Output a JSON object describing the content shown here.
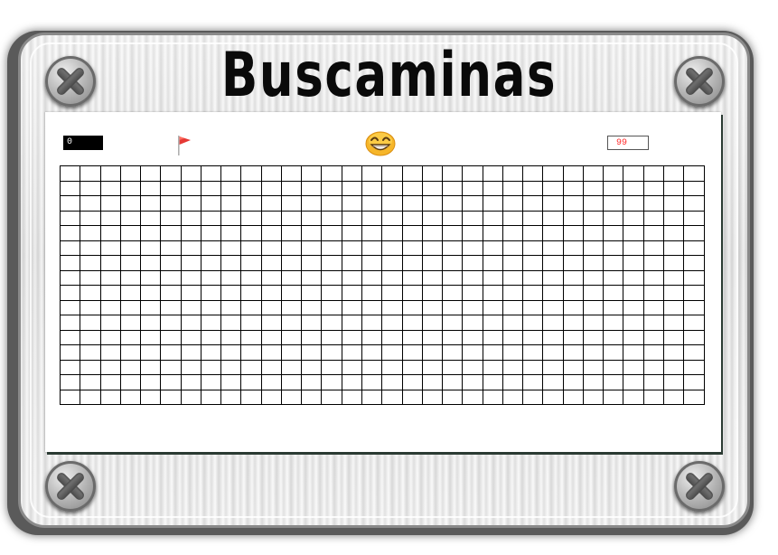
{
  "title": "Buscaminas",
  "header": {
    "mine_counter": "0",
    "timer": "99"
  },
  "icons": {
    "flag": "flag-icon",
    "reset": "smiley-face-icon",
    "screws": "screw-icon"
  },
  "board": {
    "rows": 16,
    "columns": 32,
    "cells": "unrevealed"
  },
  "colors": {
    "counter_bg": "#000000",
    "timer_text": "#ff2a2a",
    "grid_lines": "#000000",
    "flag": "#e53935",
    "smiley": "#f6b62a"
  }
}
